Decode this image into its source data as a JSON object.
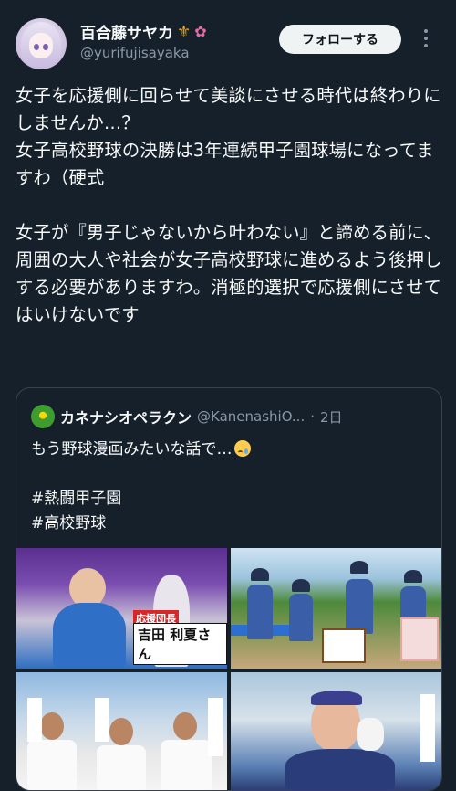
{
  "author": {
    "display_name": "百合藤サヤカ",
    "handle": "@yurifujisayaka",
    "name_emojis": [
      "fleur-de-lis",
      "flower"
    ]
  },
  "follow_button": {
    "label": "フォローする"
  },
  "more_menu": {
    "icon": "more-vertical-icon"
  },
  "tweet": {
    "text": "女子を応援側に回らせて美談にさせる時代は終わりにしませんか…？\n女子高校野球の決勝は3年連続甲子園球場になってますわ（硬式\n\n女子が『男子じゃないから叶わない』と諦める前に、周囲の大人や社会が女子高校野球に進めるよう後押しする必要がありますわ。消極的選択で応援側にさせてはいけないです"
  },
  "quote": {
    "display_name": "カネナシオペラクン",
    "handle": "@KanenashiO...",
    "separator": "·",
    "time": "2日",
    "text_line1": "もう野球漫画みたいな話で…",
    "text_emoji": "crying-face",
    "hashtags": [
      "#熱闘甲子園",
      "#高校野球"
    ],
    "media": [
      {
        "name": "cheering-girl-image",
        "caption_tag": "応援団長",
        "caption_name": "吉田 利夏さん"
      },
      {
        "name": "team-photo-image"
      },
      {
        "name": "three-players-image"
      },
      {
        "name": "crying-girl-image"
      }
    ]
  },
  "colors": {
    "background": "#15202b",
    "text_primary": "#f7f9f9",
    "text_secondary": "#8b98a5",
    "border": "#38444d",
    "follow_button_bg": "#eff3f4"
  }
}
